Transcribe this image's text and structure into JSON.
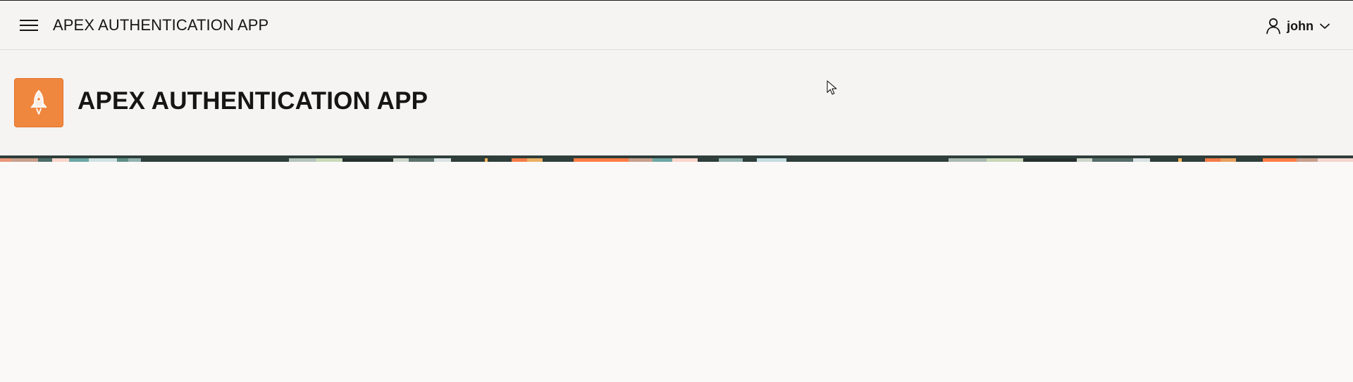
{
  "header": {
    "app_title": "APEX AUTHENTICATION APP",
    "menu_icon": "hamburger-menu-icon",
    "user": {
      "name": "john",
      "icon": "user-icon",
      "dropdown_icon": "chevron-down-icon"
    }
  },
  "hero": {
    "title": "APEX AUTHENTICATION APP",
    "icon": "rocket-icon",
    "icon_color": "#f0873f"
  },
  "colors": {
    "background": "#faf9f8",
    "header_background": "#f5f4f2",
    "accent": "#f0873f",
    "pattern_dark": "#2f3e3b"
  }
}
